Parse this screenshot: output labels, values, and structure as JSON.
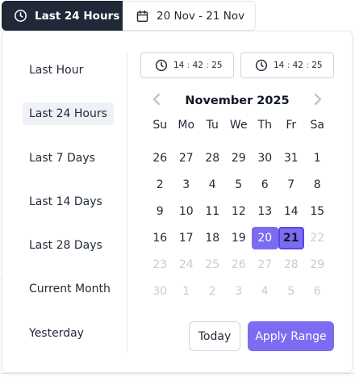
{
  "toolbar": {
    "active_label": "Last 24 Hours",
    "range_label": "20 Nov - 21 Nov"
  },
  "presets": [
    "Last Hour",
    "Last 24 Hours",
    "Last 7 Days",
    "Last 14 Days",
    "Last 28 Days",
    "Current Month",
    "Yesterday"
  ],
  "active_preset": "Last 24 Hours",
  "time_start": {
    "h": "14",
    "m": "42",
    "s": "25",
    "sep": ":"
  },
  "time_end": {
    "h": "14",
    "m": "42",
    "s": "25",
    "sep": ":"
  },
  "calendar": {
    "month_title": "November 2025",
    "weekdays": [
      "Su",
      "Mo",
      "Tu",
      "We",
      "Th",
      "Fr",
      "Sa"
    ],
    "weeks": [
      [
        "26",
        "27",
        "28",
        "29",
        "30",
        "31",
        "1"
      ],
      [
        "2",
        "3",
        "4",
        "5",
        "6",
        "7",
        "8"
      ],
      [
        "9",
        "10",
        "11",
        "12",
        "13",
        "14",
        "15"
      ],
      [
        "16",
        "17",
        "18",
        "19",
        "20",
        "21",
        "22"
      ],
      [
        "23",
        "24",
        "25",
        "26",
        "27",
        "28",
        "29"
      ],
      [
        "30",
        "1",
        "2",
        "3",
        "4",
        "5",
        "6"
      ]
    ],
    "muted_after_week3_col": 6
  },
  "actions": {
    "today_label": "Today",
    "apply_label": "Apply Range"
  },
  "colors": {
    "accent": "#7c6cf2",
    "dark": "#1f2937",
    "muted": "#c8ccd2"
  },
  "icons": {
    "clock": "clock-icon",
    "calendar": "calendar-icon",
    "prev": "chevron-left-icon",
    "next": "chevron-right-icon"
  }
}
